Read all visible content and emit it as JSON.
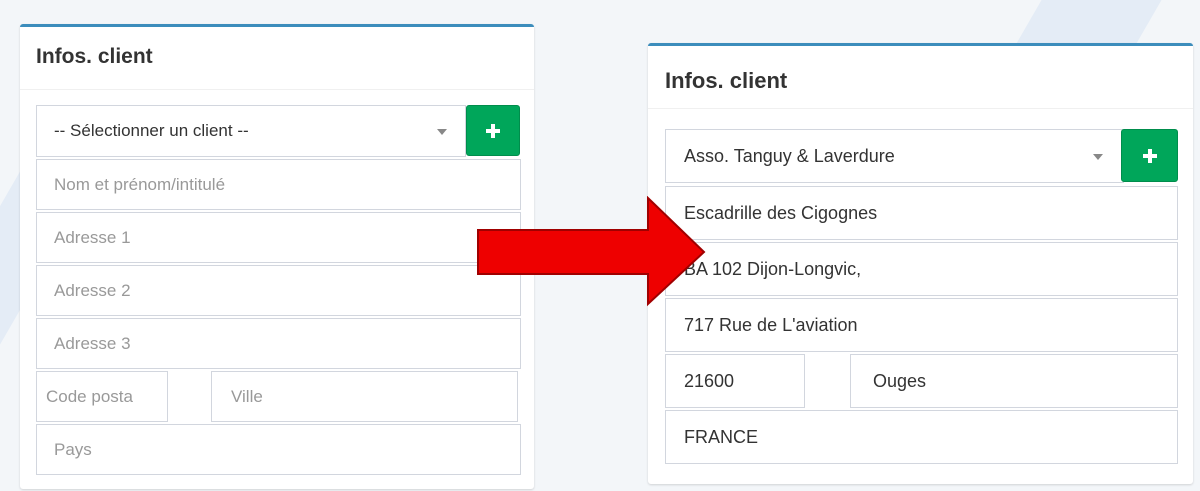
{
  "before": {
    "title": "Infos. client",
    "client_select": "-- Sélectionner un client --",
    "add_button_icon": "plus-icon",
    "name_placeholder": "Nom et prénom/intitulé",
    "address1_placeholder": "Adresse 1",
    "address2_placeholder": "Adresse 2",
    "address3_placeholder": "Adresse 3",
    "postcode_placeholder": "Code posta",
    "city_placeholder": "Ville",
    "country_placeholder": "Pays"
  },
  "after": {
    "title": "Infos. client",
    "client_select": "Asso. Tanguy & Laverdure",
    "add_button_icon": "plus-icon",
    "name": "Escadrille des Cigognes",
    "address1": "BA 102 Dijon-Longvic,",
    "address2": "717 Rue de L'aviation",
    "postcode": "21600",
    "city": "Ouges",
    "country": "FRANCE"
  },
  "colors": {
    "accent": "#3c8dbc",
    "add_button": "#00a65a",
    "arrow": "#ee0000"
  }
}
